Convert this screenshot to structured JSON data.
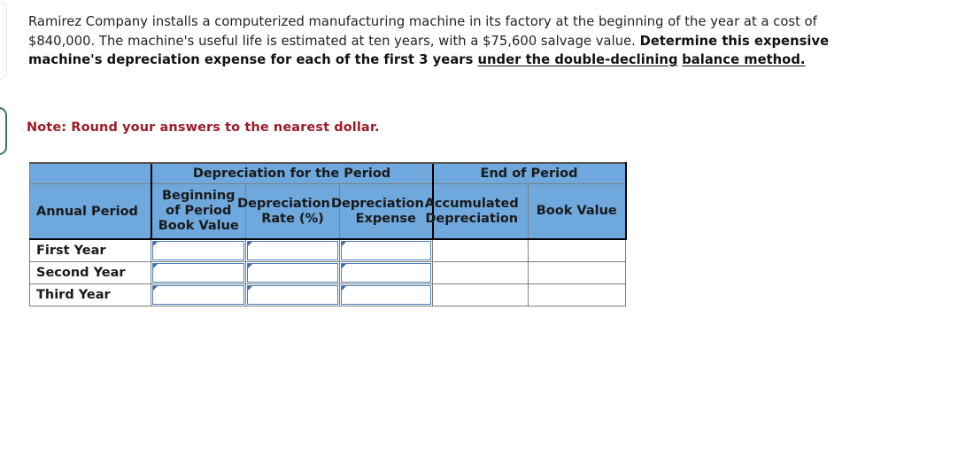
{
  "problem": {
    "line1_a": "Ramirez Company installs a computerized manufacturing machine in its factory at the beginning of the year at a cost",
    "line2_a": "of $840,000. The machine's useful life is estimated at ten years, with a $75,600 salvage value.",
    "line3_bold": "Determine this expensive machine's depreciation expense for each of the first 3 years ",
    "line3_underline": "under the double-declining",
    "line4_underline": "balance method. "
  },
  "note": {
    "text": "Note: Round your answers to the nearest dollar."
  },
  "table": {
    "group_headers": {
      "blank": "",
      "depreciation_for_period": "Depreciation for the Period",
      "end_of_period": "End of Period"
    },
    "column_headers": {
      "annual_period": "Annual Period",
      "beginning_book_value_l1": "Beginning",
      "beginning_book_value_l2": "of Period",
      "beginning_book_value_l3": "Book Value",
      "rate_l1": "Depreciation",
      "rate_l2": "Rate (%)",
      "expense_l1": "Depreciation",
      "expense_l2": "Expense",
      "accumulated_l1": "Accumulated",
      "accumulated_l2": "Depreciation",
      "book_value": "Book Value"
    },
    "rows": [
      {
        "period": "First Year",
        "beginning_book_value": "",
        "rate": "",
        "expense": "",
        "accumulated": "",
        "book_value": ""
      },
      {
        "period": "Second Year",
        "beginning_book_value": "",
        "rate": "",
        "expense": "",
        "accumulated": "",
        "book_value": ""
      },
      {
        "period": "Third Year",
        "beginning_book_value": "",
        "rate": "",
        "expense": "",
        "accumulated": "",
        "book_value": ""
      }
    ]
  },
  "colors": {
    "header_blue": "#6fa8dc",
    "note_red": "#9e1b28",
    "input_border_blue": "#4a7ebb",
    "cell_border_gray": "#7d7d7d",
    "accent_green": "#3b7d4f"
  }
}
